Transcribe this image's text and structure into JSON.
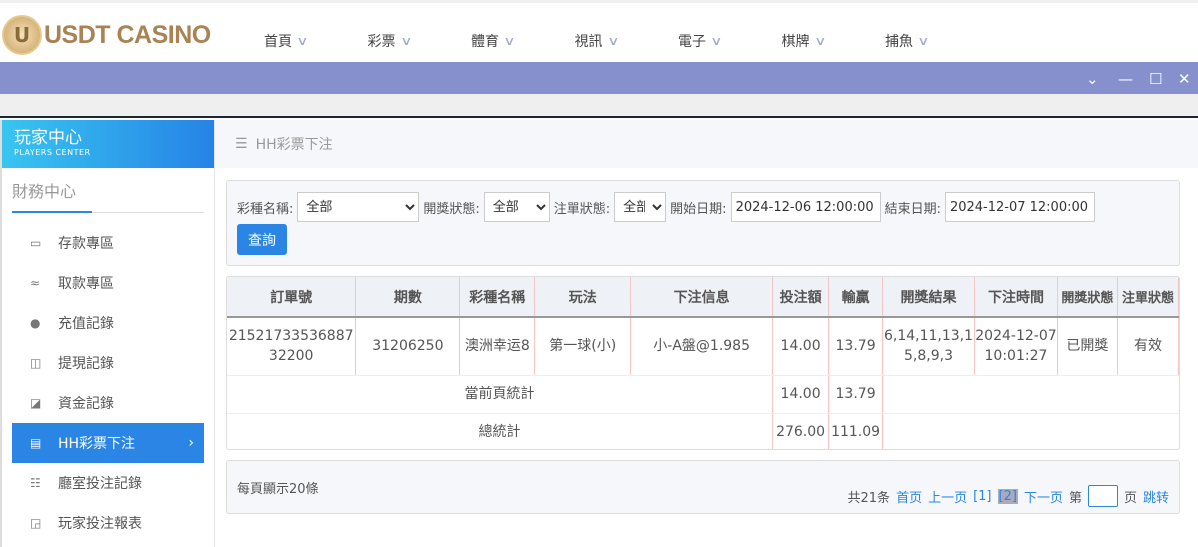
{
  "brand": {
    "logo_text": "USDT CASINO",
    "logo_letter": "U"
  },
  "nav": [
    {
      "label": "首頁"
    },
    {
      "label": "彩票"
    },
    {
      "label": "體育"
    },
    {
      "label": "視訊"
    },
    {
      "label": "電子"
    },
    {
      "label": "棋牌"
    },
    {
      "label": "捕魚"
    }
  ],
  "window": {
    "minimize": "—",
    "maximize": "☐",
    "close": "✕",
    "collapse": "⌄"
  },
  "sidebar": {
    "title": "玩家中心",
    "subtitle": "PLAYERS CENTER",
    "section": "財務中心",
    "items": [
      {
        "label": "存款專區",
        "icon": "card-icon"
      },
      {
        "label": "取款專區",
        "icon": "hand-money-icon"
      },
      {
        "label": "充值記錄",
        "icon": "money-bag-icon"
      },
      {
        "label": "提現記錄",
        "icon": "wallet-icon"
      },
      {
        "label": "資金記錄",
        "icon": "cash-icon"
      },
      {
        "label": "HH彩票下注",
        "icon": "list-icon",
        "active": true
      },
      {
        "label": "廳室投注記錄",
        "icon": "list-detail-icon"
      },
      {
        "label": "玩家投注報表",
        "icon": "chart-icon"
      }
    ]
  },
  "breadcrumb": "HH彩票下注",
  "filters": {
    "lottery_label": "彩種名稱:",
    "lottery_value": "全部",
    "draw_label": "開獎狀態:",
    "draw_value": "全部",
    "order_label": "注單狀態:",
    "order_value": "全部",
    "start_label": "開始日期:",
    "start_value": "2024-12-06 12:00:00",
    "end_label": "結束日期:",
    "end_value": "2024-12-07 12:00:00",
    "query": "查詢"
  },
  "table": {
    "headers": [
      "訂單號",
      "期數",
      "彩種名稱",
      "玩法",
      "下注信息",
      "投注額",
      "輸贏",
      "開獎結果",
      "下注時間",
      "開獎狀態",
      "注單狀態"
    ],
    "rows": [
      [
        "2152173353688732200",
        "31206250",
        "澳洲幸运8",
        "第一球(小)",
        "小-A盤@1.985",
        "14.00",
        "13.79",
        "6,14,11,13,15,8,9,3",
        "2024-12-07 10:01:27",
        "已開獎",
        "有效"
      ]
    ],
    "page_total_label": "當前頁統計",
    "page_total_bet": "14.00",
    "page_total_win": "13.79",
    "grand_total_label": "總統計",
    "grand_total_bet": "276.00",
    "grand_total_win": "111.09"
  },
  "pager": {
    "per_page": "每頁顯示20條",
    "total": "共21条",
    "first": "首页",
    "prev": "上一页",
    "p1": "[1]",
    "p2": "[2]",
    "next": "下一页",
    "page_prefix": "第",
    "page_suffix": "页",
    "jump": "跳转"
  }
}
